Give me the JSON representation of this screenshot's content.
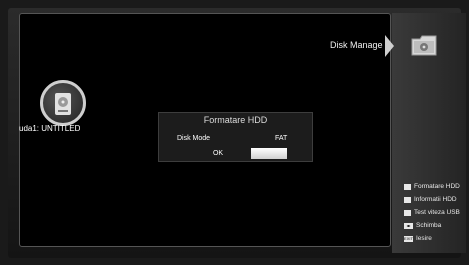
{
  "header": {
    "section_label": "Disk Manage"
  },
  "device": {
    "name": "uda1: UNTITLED"
  },
  "dialog": {
    "title": "Formatare HDD",
    "disk_mode_label": "Disk Mode",
    "disk_mode_value": "FAT",
    "ok_label": "OK"
  },
  "menu": {
    "items": [
      {
        "label": "Formatare HDD",
        "icon": "square-bullet-icon"
      },
      {
        "label": "Informatii HDD",
        "icon": "square-bullet-icon"
      },
      {
        "label": "Test viteza USB",
        "icon": "square-bullet-icon"
      },
      {
        "label": "Schimba",
        "icon": "key-badge-icon"
      },
      {
        "label": "Iesire",
        "icon": "key-badge-icon"
      }
    ]
  }
}
